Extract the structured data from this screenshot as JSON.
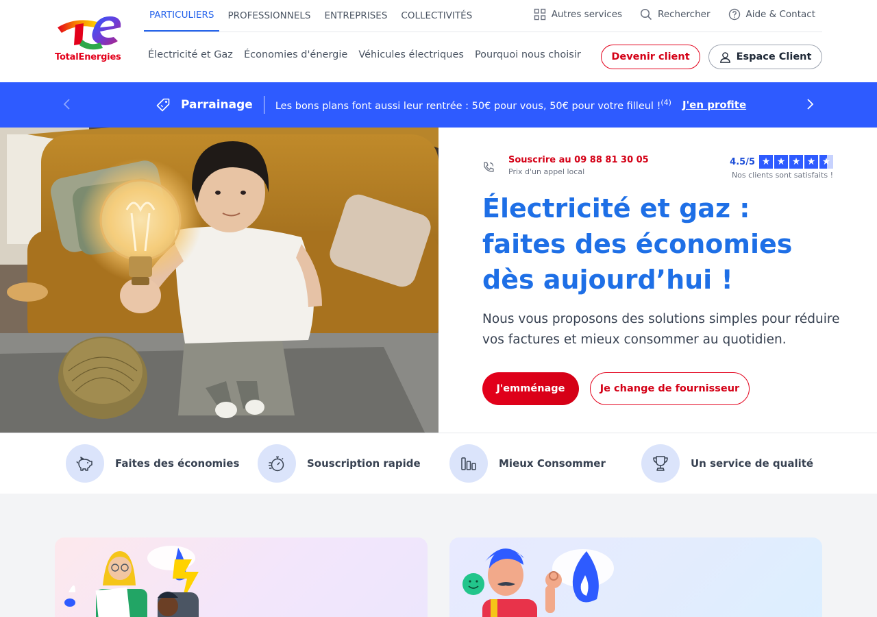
{
  "brand": {
    "name": "TotalEnergies"
  },
  "top_tabs": [
    {
      "label": "PARTICULIERS",
      "active": true
    },
    {
      "label": "PROFESSIONNELS",
      "active": false
    },
    {
      "label": "ENTREPRISES",
      "active": false
    },
    {
      "label": "COLLECTIVITÉS",
      "active": false
    }
  ],
  "utilities": {
    "services": "Autres services",
    "search": "Rechercher",
    "help": "Aide & Contact"
  },
  "subnav": [
    "Électricité et Gaz",
    "Économies d'énergie",
    "Véhicules électriques",
    "Pourquoi nous choisir"
  ],
  "header_buttons": {
    "become_client": "Devenir client",
    "client_space": "Espace Client"
  },
  "banner": {
    "title": "Parrainage",
    "text": "Les bons plans font aussi leur rentrée : 50€ pour vous, 50€ pour votre filleul !",
    "footnote": "(4)",
    "link": "J'en profite"
  },
  "hero": {
    "phone_label": "Souscrire au 09 88 81 30 05",
    "phone_sub": "Prix d'un appel local",
    "rating_value": "4.5/5",
    "rating_score": 4.5,
    "rating_sub": "Nos clients sont satisfaits !",
    "title": "Électricité et gaz : faites des économies dès aujourd’hui !",
    "description": "Nous vous proposons des solutions simples pour réduire vos factures et mieux consommer au quotidien.",
    "primary_button": "J'emménage",
    "secondary_button": "Je change de fournisseur"
  },
  "features": [
    {
      "label": "Faites des économies",
      "icon": "piggy-bank-icon"
    },
    {
      "label": "Souscription rapide",
      "icon": "stopwatch-icon"
    },
    {
      "label": "Mieux Consommer",
      "icon": "bar-chart-icon"
    },
    {
      "label": "Un service de qualité",
      "icon": "trophy-icon"
    }
  ],
  "colors": {
    "brand_red": "#e3001b",
    "brand_blue": "#2e5bff",
    "title_blue": "#1e6fe6",
    "feature_icon_bg": "#dbe4fb"
  }
}
